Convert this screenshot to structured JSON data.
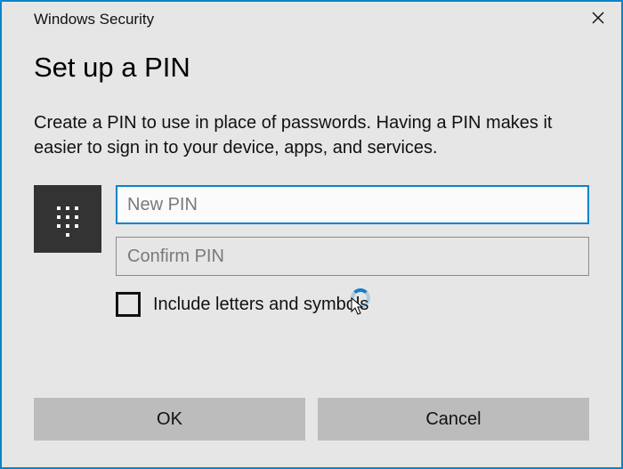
{
  "titlebar": {
    "title": "Windows Security"
  },
  "heading": "Set up a PIN",
  "description": "Create a PIN to use in place of passwords. Having a PIN makes it easier to sign in to your device, apps, and services.",
  "fields": {
    "new_pin": {
      "value": "",
      "placeholder": "New PIN"
    },
    "confirm_pin": {
      "value": "",
      "placeholder": "Confirm PIN"
    }
  },
  "checkbox": {
    "label": "Include letters and symbols",
    "checked": false
  },
  "buttons": {
    "ok": "OK",
    "cancel": "Cancel"
  },
  "icons": {
    "pin": "pin-keypad",
    "close": "close-x",
    "busy": "busy-spinner"
  }
}
